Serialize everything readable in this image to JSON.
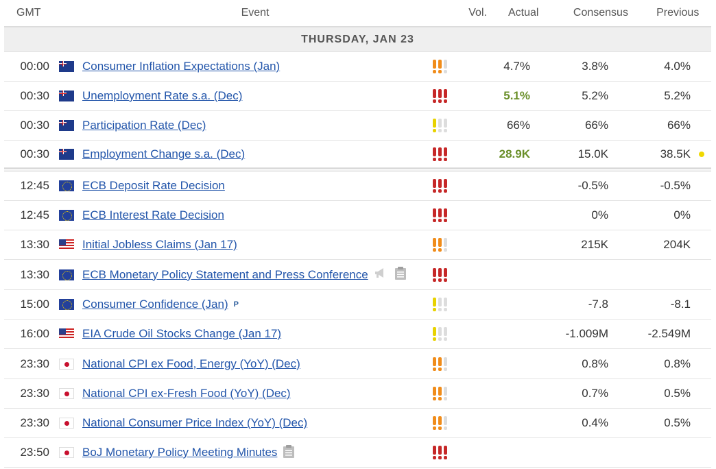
{
  "header": {
    "gmt": "GMT",
    "event": "Event",
    "vol": "Vol.",
    "actual": "Actual",
    "consensus": "Consensus",
    "previous": "Previous"
  },
  "day": "THURSDAY, JAN 23",
  "colors": {
    "high": "#c62828",
    "medium": "#f08c1a",
    "low": "#e8d200",
    "good": "#6a8f2a",
    "link": "#2255aa"
  },
  "rows": [
    {
      "time": "00:00",
      "flag": "au",
      "event": "Consumer Inflation Expectations (Jan)",
      "vol": 2,
      "actual": "4.7%",
      "consensus": "3.8%",
      "previous": "4.0%"
    },
    {
      "time": "00:30",
      "flag": "au",
      "event": "Unemployment Rate s.a. (Dec)",
      "vol": 3,
      "actual": "5.1%",
      "actual_good": true,
      "consensus": "5.2%",
      "previous": "5.2%"
    },
    {
      "time": "00:30",
      "flag": "au",
      "event": "Participation Rate (Dec)",
      "vol": 1,
      "actual": "66%",
      "consensus": "66%",
      "previous": "66%"
    },
    {
      "time": "00:30",
      "flag": "au",
      "event": "Employment Change s.a. (Dec)",
      "vol": 3,
      "actual": "28.9K",
      "actual_good": true,
      "consensus": "15.0K",
      "previous": "38.5K",
      "revised_dot": true
    },
    {
      "separator": true
    },
    {
      "time": "12:45",
      "flag": "eu",
      "event": "ECB Deposit Rate Decision",
      "vol": 3,
      "actual": "",
      "consensus": "-0.5%",
      "previous": "-0.5%"
    },
    {
      "time": "12:45",
      "flag": "eu",
      "event": "ECB Interest Rate Decision",
      "vol": 3,
      "actual": "",
      "consensus": "0%",
      "previous": "0%"
    },
    {
      "time": "13:30",
      "flag": "us",
      "event": "Initial Jobless Claims (Jan 17)",
      "vol": 2,
      "actual": "",
      "consensus": "215K",
      "previous": "204K"
    },
    {
      "time": "13:30",
      "flag": "eu",
      "event": "ECB Monetary Policy Statement and Press Conference",
      "vol": 3,
      "actual": "",
      "consensus": "",
      "previous": "",
      "icons": [
        "megaphone-icon",
        "clipboard-icon"
      ]
    },
    {
      "time": "15:00",
      "flag": "eu",
      "event": "Consumer Confidence (Jan)",
      "vol": 1,
      "actual": "",
      "consensus": "-7.8",
      "previous": "-8.1",
      "preliminary": "P"
    },
    {
      "time": "16:00",
      "flag": "us",
      "event": "EIA Crude Oil Stocks Change (Jan 17)",
      "vol": 1,
      "actual": "",
      "consensus": "-1.009M",
      "previous": "-2.549M"
    },
    {
      "time": "23:30",
      "flag": "jp",
      "event": "National CPI ex Food, Energy (YoY) (Dec)",
      "vol": 2,
      "actual": "",
      "consensus": "0.8%",
      "previous": "0.8%"
    },
    {
      "time": "23:30",
      "flag": "jp",
      "event": "National CPI ex-Fresh Food (YoY) (Dec)",
      "vol": 2,
      "actual": "",
      "consensus": "0.7%",
      "previous": "0.5%"
    },
    {
      "time": "23:30",
      "flag": "jp",
      "event": "National Consumer Price Index (YoY) (Dec)",
      "vol": 2,
      "actual": "",
      "consensus": "0.4%",
      "previous": "0.5%"
    },
    {
      "time": "23:50",
      "flag": "jp",
      "event": "BoJ Monetary Policy Meeting Minutes",
      "vol": 3,
      "actual": "",
      "consensus": "",
      "previous": "",
      "icons": [
        "clipboard-icon"
      ]
    }
  ]
}
